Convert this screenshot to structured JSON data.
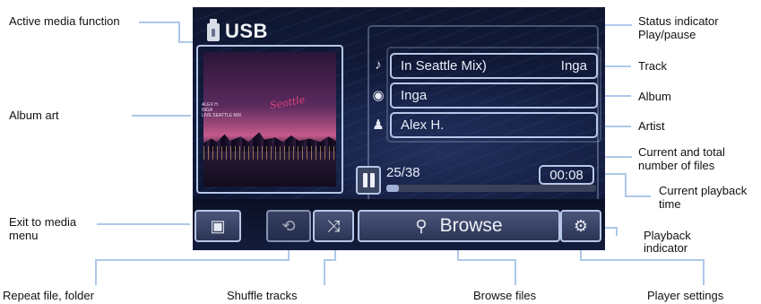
{
  "screen": {
    "source_label": "USB",
    "track": {
      "title": "In  Seattle  Mix)",
      "artist_tag": "Inga"
    },
    "album": "Inga",
    "artist": "Alex  H.",
    "file_counter": "25/38",
    "playback_time": "00:08",
    "progress_fraction": 0.06,
    "browse_label": "Browse",
    "album_art_text": {
      "line1": "ALEX H.",
      "line2": "INGA",
      "line3": "LIVE SEATTLE MIX",
      "script": "Seattle"
    }
  },
  "callouts": {
    "active_media_function": "Active media function",
    "album_art": "Album art",
    "exit_line1": "Exit to media",
    "exit_line2": "menu",
    "repeat": "Repeat file, folder",
    "shuffle": "Shuffle tracks",
    "browse_files": "Browse files",
    "player_settings": "Player settings",
    "status_line1": "Status indicator",
    "status_line2": "Play/pause",
    "track": "Track",
    "album": "Album",
    "artist": "Artist",
    "files_line1": "Current and total",
    "files_line2": "number of files",
    "time_line1": "Current playback",
    "time_line2": "time",
    "indicator_line1": "Playback",
    "indicator_line2": "indicator"
  },
  "icons": {
    "usb": "usb-icon",
    "music_note": "music-note-icon",
    "disc": "disc-icon",
    "artist": "artist-icon",
    "pause": "pause-icon",
    "media_menu": "media-menu-icon",
    "repeat": "repeat-icon",
    "shuffle": "shuffle-icon",
    "search": "search-icon",
    "settings": "settings-icon"
  },
  "colors": {
    "screen_bg": "#101a3c",
    "outline": "#b7c7e8",
    "callout_line": "#aec8ea",
    "text_light": "#e9eef9"
  }
}
